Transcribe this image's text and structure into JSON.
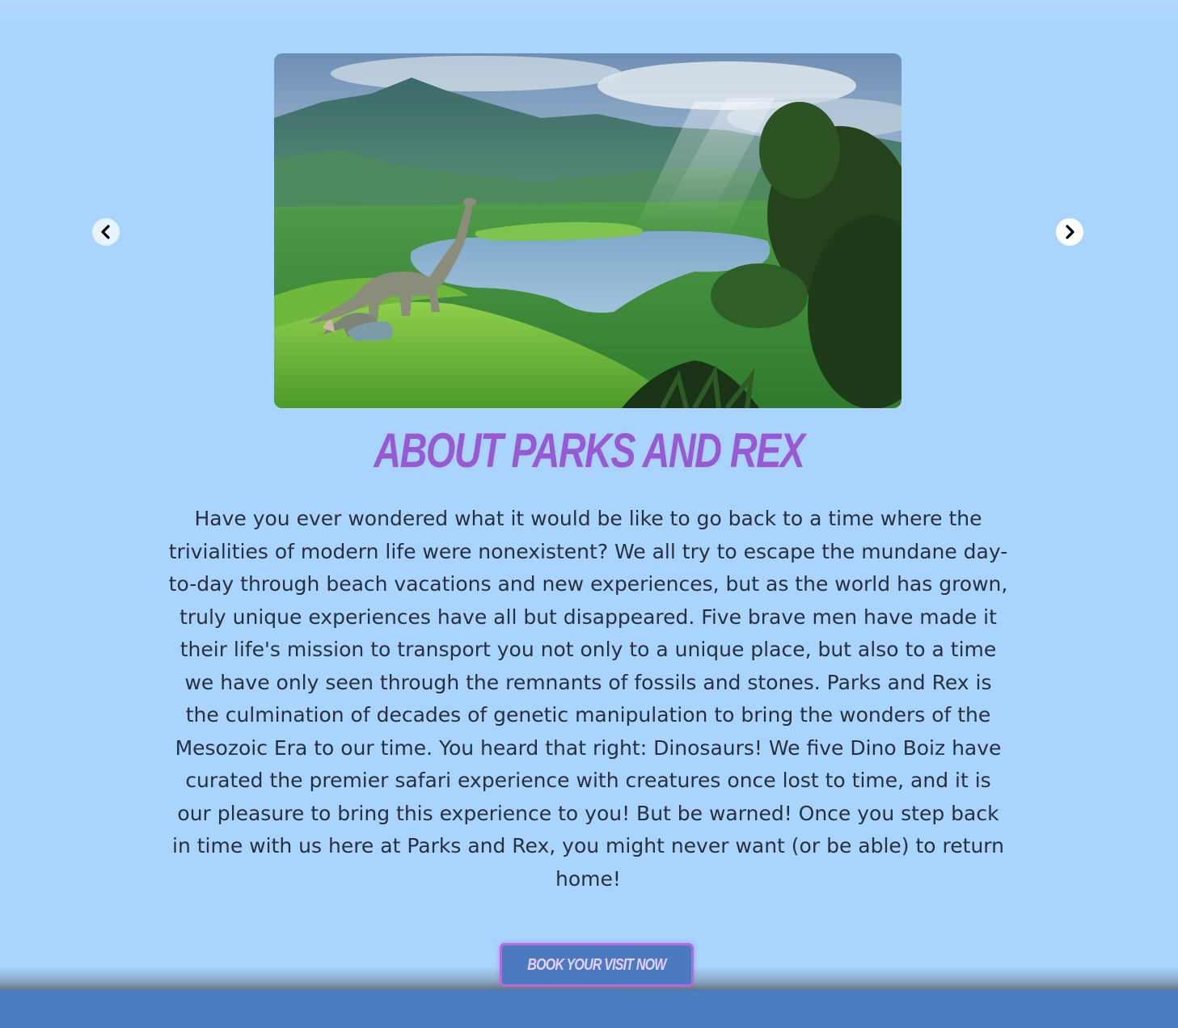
{
  "carousel": {
    "image_alt": "Dinosaurs grazing near a lake in a lush green valley",
    "prev_icon": "chevron-left-icon",
    "next_icon": "chevron-right-icon"
  },
  "about": {
    "title": "About Parks and Rex",
    "paragraph": "Have you ever wondered what it would be like to go back to a time where the trivialities of modern life were nonexistent? We all try to escape the mundane day-to-day through beach vacations and new experiences, but as the world has grown, truly unique experiences have all but disappeared. Five brave men have made it their life's mission to transport you not only to a unique place, but also to a time we have only seen through the remnants of fossils and stones. Parks and Rex is the culmination of decades of genetic manipulation to bring the wonders of the Mesozoic Era to our time. You heard that right: Dinosaurs! We five Dino Boiz have curated the premier safari experience with creatures once lost to time, and it is our pleasure to bring this experience to you! But be warned! Once you step back in time with us here at Parks and Rex, you might never want (or be able) to return home!"
  },
  "cta": {
    "label": "Book Your Visit Now"
  },
  "colors": {
    "background": "#a9d4fd",
    "title": "#9959d4",
    "button_bg": "#4c7abf",
    "button_border": "#b46bd8",
    "footer": "#4a7dbf"
  }
}
